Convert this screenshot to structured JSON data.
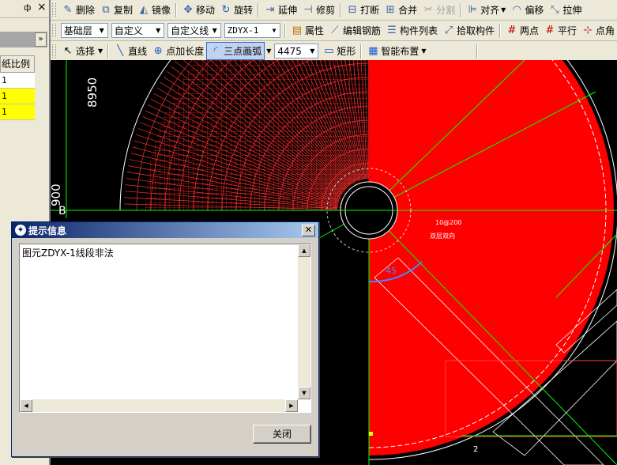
{
  "toolbar1": {
    "pin": "ф",
    "close": "×",
    "delete": "删除",
    "copy": "复制",
    "mirror": "镜像",
    "move": "移动",
    "rotate": "旋转",
    "extend": "延伸",
    "trim": "修剪",
    "break": "打断",
    "merge": "合并",
    "split": "分割",
    "align": "对齐",
    "offset": "偏移",
    "stretch": "拉伸"
  },
  "toolbar2": {
    "layer": "基础层",
    "custom": "自定义",
    "custom_line": "自定义线",
    "element": "ZDYX-1",
    "properties": "属性",
    "edit_rebar": "编辑钢筋",
    "component_list": "构件列表",
    "pick_component": "拾取构件",
    "two_points": "两点",
    "parallel": "平行",
    "point_angle": "点角"
  },
  "toolbar3": {
    "select": "选择",
    "line": "直线",
    "point_length": "点加长度",
    "three_point_arc": "三点画弧",
    "value": "4475",
    "rectangle": "矩形",
    "smart_layout": "智能布置"
  },
  "left_panel": {
    "header": "纸比例",
    "rows": [
      "1",
      "1",
      "1"
    ],
    "expand": "»"
  },
  "canvas": {
    "dim_top": "8950",
    "dim_left": "900",
    "axis_label": "B",
    "rebar_text": "10@200",
    "rebar_sub": "双层双向",
    "angle": "45",
    "small_label": "2"
  },
  "dialog": {
    "title": "提示信息",
    "message": "图元ZDYX-1线段非法",
    "close_button": "关闭"
  },
  "colors": {
    "fill": "#ff0000",
    "guide": "#00ff00"
  }
}
